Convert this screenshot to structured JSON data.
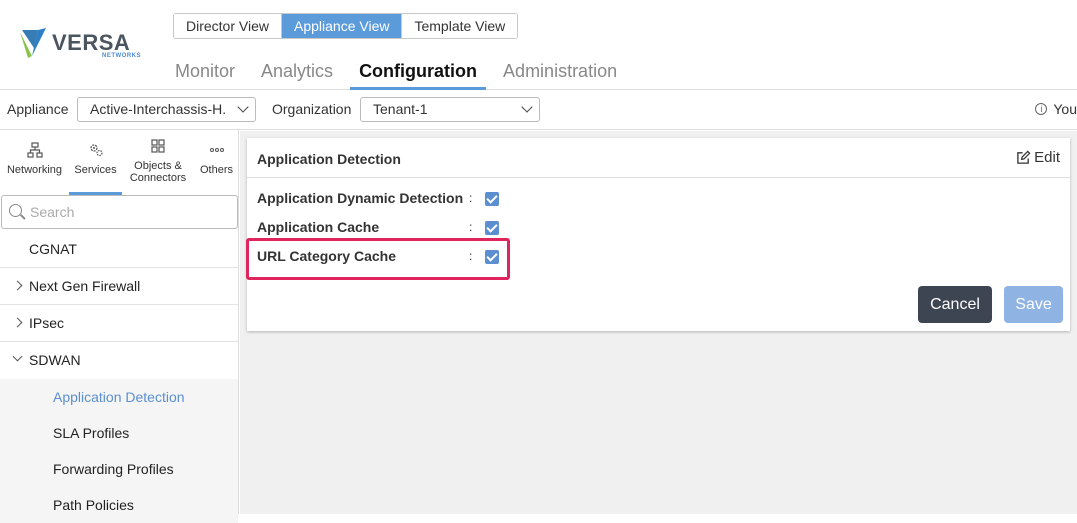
{
  "brand": {
    "name": "VERSA",
    "sub": "NETWORKS"
  },
  "views": [
    {
      "label": "Director View",
      "active": false
    },
    {
      "label": "Appliance View",
      "active": true
    },
    {
      "label": "Template View",
      "active": false
    }
  ],
  "main_tabs": [
    {
      "label": "Monitor",
      "active": false
    },
    {
      "label": "Analytics",
      "active": false
    },
    {
      "label": "Configuration",
      "active": true
    },
    {
      "label": "Administration",
      "active": false
    }
  ],
  "appbar": {
    "appliance_label": "Appliance",
    "appliance_value": "Active-Interchassis-H.",
    "organization_label": "Organization",
    "organization_value": "Tenant-1",
    "you_text": "You"
  },
  "sidebar": {
    "categories": [
      {
        "label": "Networking",
        "icon": "network-icon"
      },
      {
        "label": "Services",
        "icon": "gears-icon",
        "active": true
      },
      {
        "label": "Objects & Connectors",
        "icon": "objects-icon"
      },
      {
        "label": "Others",
        "icon": "more-icon"
      }
    ],
    "search_placeholder": "Search",
    "items": [
      {
        "label": "CGNAT"
      },
      {
        "label": "Next Gen Firewall"
      },
      {
        "label": "IPsec"
      },
      {
        "label": "SDWAN"
      }
    ],
    "sdwan_children": [
      {
        "label": "Application Detection",
        "active": true
      },
      {
        "label": "SLA Profiles"
      },
      {
        "label": "Forwarding Profiles"
      },
      {
        "label": "Path Policies"
      }
    ]
  },
  "panel": {
    "title": "Application Detection",
    "edit_label": "Edit",
    "fields": [
      {
        "label": "Application Dynamic Detection",
        "colon": ":",
        "checked": true
      },
      {
        "label": "Application Cache",
        "colon": ":",
        "checked": true
      },
      {
        "label": "URL Category Cache",
        "colon": ":",
        "checked": true
      }
    ],
    "cancel_label": "Cancel",
    "save_label": "Save"
  },
  "colors": {
    "accent": "#5b9bd9",
    "highlight": "#e0245e",
    "cancel": "#3d4452",
    "save": "#8fb3e3"
  }
}
